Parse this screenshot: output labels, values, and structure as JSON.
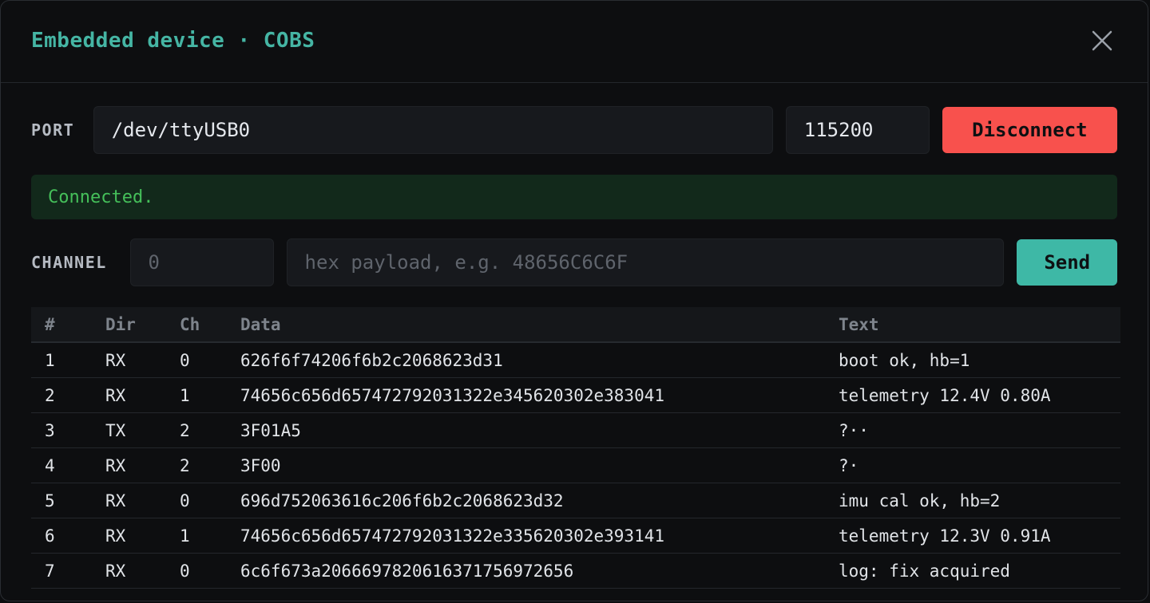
{
  "dialog": {
    "title": "Embedded device · COBS"
  },
  "port_row": {
    "label": "PORT",
    "port_value": "/dev/ttyUSB0",
    "baud_value": "115200",
    "disconnect_label": "Disconnect"
  },
  "status": {
    "text": "Connected."
  },
  "send_row": {
    "label": "CHANNEL",
    "channel_placeholder": "0",
    "payload_placeholder": "hex payload, e.g. 48656C6C6F",
    "send_label": "Send"
  },
  "table": {
    "headers": [
      "#",
      "Dir",
      "Ch",
      "Data",
      "Text"
    ],
    "rows": [
      [
        "1",
        "RX",
        "0",
        "626f6f74206f6b2c2068623d31",
        "boot ok, hb=1"
      ],
      [
        "2",
        "RX",
        "1",
        "74656c656d657472792031322e345620302e383041",
        "telemetry 12.4V 0.80A"
      ],
      [
        "3",
        "TX",
        "2",
        "3F01A5",
        "?··"
      ],
      [
        "4",
        "RX",
        "2",
        "3F00",
        "?·"
      ],
      [
        "5",
        "RX",
        "0",
        "696d752063616c206f6b2c2068623d32",
        "imu cal ok, hb=2"
      ],
      [
        "6",
        "RX",
        "1",
        "74656c656d657472792031322e335620302e393141",
        "telemetry 12.3V 0.91A"
      ],
      [
        "7",
        "RX",
        "0",
        "6c6f673a2066697820616371756972656",
        "log: fix acquired"
      ]
    ]
  },
  "colors": {
    "accent": "#45b5a4",
    "danger": "#f8514d",
    "success_text": "#45c05a",
    "success_bg": "#12291b"
  },
  "icons": {
    "close": "close-icon"
  }
}
